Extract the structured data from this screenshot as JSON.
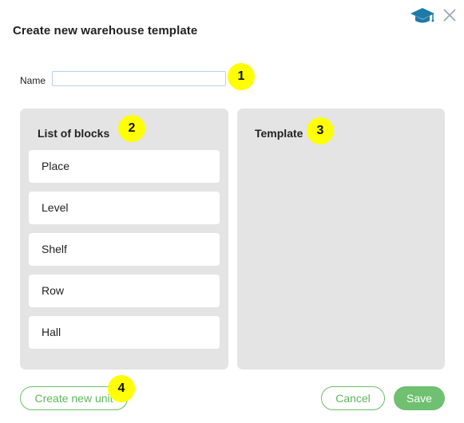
{
  "dialog": {
    "title": "Create new warehouse template"
  },
  "icons": {
    "help": "graduation-cap-icon",
    "close": "close-icon",
    "accent": "#1f7aa8"
  },
  "form": {
    "name_label": "Name",
    "name_value": ""
  },
  "blocks": {
    "title": "List of blocks",
    "items": [
      {
        "label": "Place"
      },
      {
        "label": "Level"
      },
      {
        "label": "Shelf"
      },
      {
        "label": "Row"
      },
      {
        "label": "Hall"
      }
    ]
  },
  "template": {
    "title": "Template"
  },
  "markers": [
    "1",
    "2",
    "3",
    "4"
  ],
  "buttons": {
    "create_unit": "Create new unit",
    "cancel": "Cancel",
    "save": "Save"
  },
  "colors": {
    "panel_bg": "#e4e4e4",
    "green": "#6fc070",
    "marker": "#ffff00"
  }
}
